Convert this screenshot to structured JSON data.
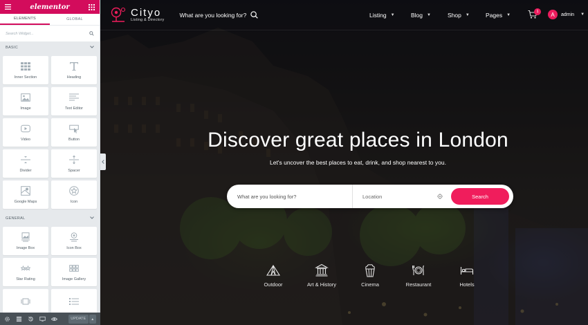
{
  "panel": {
    "logo": "elementor",
    "tabs": [
      {
        "label": "ELEMENTS"
      },
      {
        "label": "GLOBAL"
      }
    ],
    "search_placeholder": "Search Widget...",
    "categories": [
      {
        "title": "BASIC",
        "widgets": [
          {
            "label": "Inner Section",
            "icon": "inner-section-icon"
          },
          {
            "label": "Heading",
            "icon": "heading-icon"
          },
          {
            "label": "Image",
            "icon": "image-icon"
          },
          {
            "label": "Text Editor",
            "icon": "text-editor-icon"
          },
          {
            "label": "Video",
            "icon": "video-icon"
          },
          {
            "label": "Button",
            "icon": "button-icon"
          },
          {
            "label": "Divider",
            "icon": "divider-icon"
          },
          {
            "label": "Spacer",
            "icon": "spacer-icon"
          },
          {
            "label": "Google Maps",
            "icon": "google-maps-icon"
          },
          {
            "label": "Icon",
            "icon": "star-icon"
          }
        ]
      },
      {
        "title": "GENERAL",
        "widgets": [
          {
            "label": "Image Box",
            "icon": "image-box-icon"
          },
          {
            "label": "Icon Box",
            "icon": "icon-box-icon"
          },
          {
            "label": "Star Rating",
            "icon": "star-rating-icon"
          },
          {
            "label": "Image Gallery",
            "icon": "image-gallery-icon"
          },
          {
            "label": "",
            "icon": "image-carousel-icon"
          },
          {
            "label": "",
            "icon": "icon-list-icon"
          }
        ]
      }
    ],
    "footer": {
      "update_label": "UPDATE"
    },
    "accent": "#d30c5c"
  },
  "site": {
    "logo": {
      "title": "Cityo",
      "subtitle": "Listing & Directory"
    },
    "top_search": "What are you looking for?",
    "nav": [
      {
        "label": "Listing"
      },
      {
        "label": "Blog"
      },
      {
        "label": "Shop"
      },
      {
        "label": "Pages"
      }
    ],
    "cart_count": "1",
    "user": {
      "avatar_letter": "A",
      "name": "admin"
    },
    "hero": {
      "title": "Discover great places in London",
      "subtitle": "Let's uncover the best places to eat, drink, and shop nearest to you."
    },
    "search": {
      "what_placeholder": "What are you looking for?",
      "location_placeholder": "Location",
      "button": "Search"
    },
    "categories": [
      {
        "label": "Outdoor",
        "icon": "tent-icon"
      },
      {
        "label": "Art & History",
        "icon": "museum-icon"
      },
      {
        "label": "Cinema",
        "icon": "popcorn-icon"
      },
      {
        "label": "Restaurant",
        "icon": "plate-cutlery-icon"
      },
      {
        "label": "Hotels",
        "icon": "bed-icon"
      }
    ],
    "accent": "#f01d5c"
  }
}
